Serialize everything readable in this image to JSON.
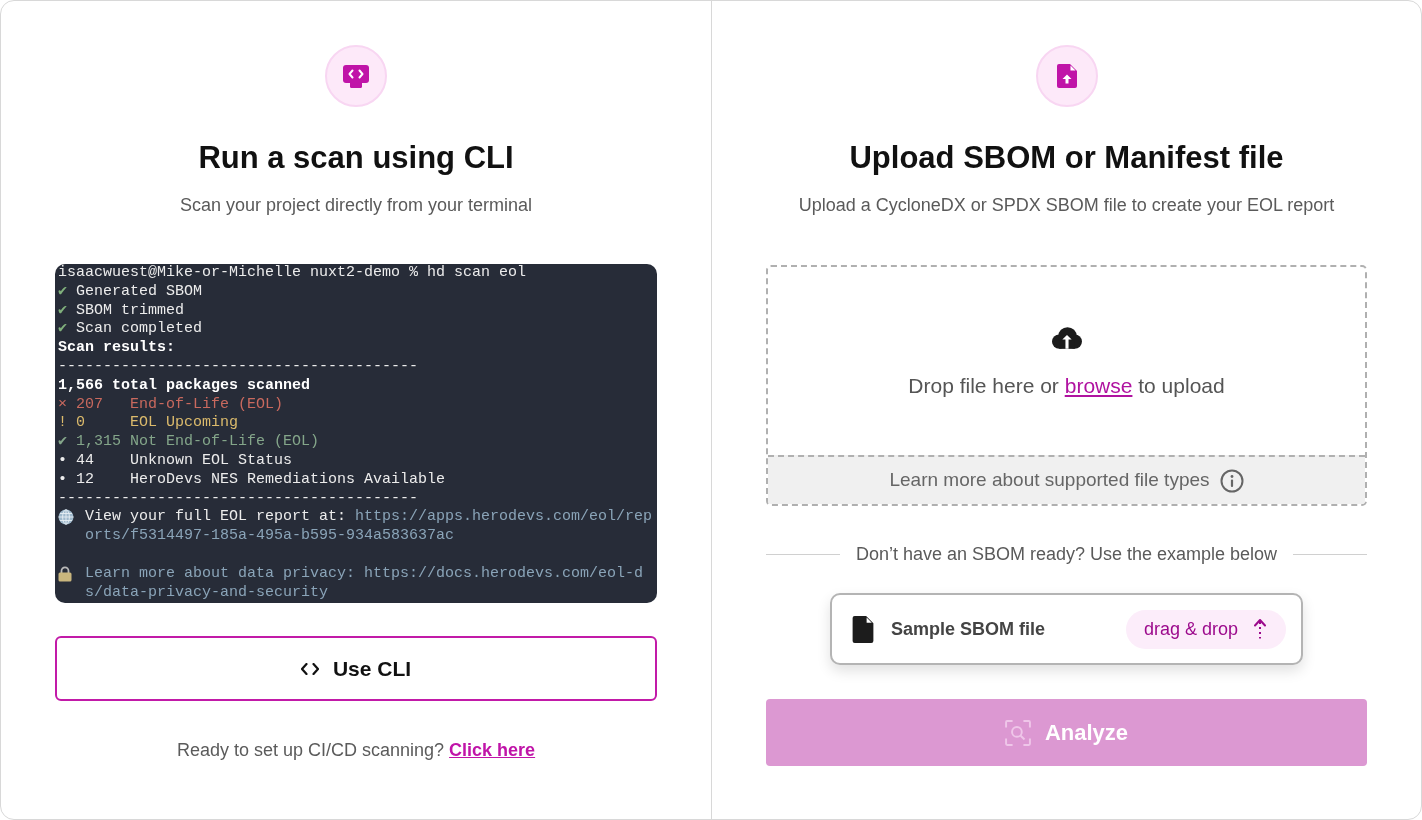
{
  "cli_panel": {
    "title": "Run a scan using CLI",
    "subtitle": "Scan your project directly from your terminal",
    "terminal": {
      "lines": [
        {
          "kind": "command",
          "text": "isaacwuest@Mike-or-Michelle nuxt2-demo % hd scan eol"
        },
        {
          "kind": "step",
          "mark": "✔",
          "text": "Generated SBOM"
        },
        {
          "kind": "step",
          "mark": "✔",
          "text": "SBOM trimmed"
        },
        {
          "kind": "step",
          "mark": "✔",
          "text": "Scan completed"
        },
        {
          "kind": "heading",
          "text": "Scan results:"
        },
        {
          "kind": "rule",
          "text": "----------------------------------------"
        },
        {
          "kind": "heading",
          "text": "1,566 total packages scanned"
        },
        {
          "kind": "result",
          "color": "#c9695e",
          "mark": "×",
          "count": "207",
          "text": "End-of-Life (EOL)"
        },
        {
          "kind": "result",
          "color": "#dcbb6c",
          "mark": "!",
          "count": "0",
          "text": "EOL Upcoming"
        },
        {
          "kind": "result",
          "color": "#84a68a",
          "mark": "✔",
          "count": "1,315",
          "text": "Not End-of-Life (EOL)"
        },
        {
          "kind": "result",
          "color": "#ececec",
          "mark": "•",
          "count": "44",
          "text": "Unknown EOL Status"
        },
        {
          "kind": "result",
          "color": "#ececec",
          "mark": "•",
          "count": "12",
          "text": "HeroDevs NES Remediations Available"
        },
        {
          "kind": "rule",
          "text": "----------------------------------------"
        },
        {
          "kind": "report",
          "text": "View your full EOL report at:",
          "url": "https://apps.herodevs.com/eol/reports/f5314497-185a-495a-b595-934a583637ac"
        },
        {
          "kind": "blank"
        },
        {
          "kind": "notice",
          "text": "Learn more about data privacy:",
          "url": "https://docs.herodevs.com/eol-ds/data-privacy-and-security"
        }
      ]
    },
    "button": {
      "label": "Use CLI"
    },
    "footer": {
      "text": "Ready to set up CI/CD scanning?",
      "link": "Click here"
    }
  },
  "upload_panel": {
    "title": "Upload SBOM or Manifest file",
    "subtitle": "Upload a CycloneDX or SPDX SBOM file to create your EOL report",
    "dropzone": {
      "prompt_before": "Drop file here or",
      "link": "browse",
      "prompt_after": "to upload",
      "help": "Learn more about supported file types"
    },
    "divider_text": "Don’t have an SBOM ready? Use the example below",
    "sample_file": {
      "name": "Sample SBOM file",
      "action": "drag & drop"
    },
    "analyze_button": {
      "label": "Analyze",
      "disabled": true
    }
  }
}
